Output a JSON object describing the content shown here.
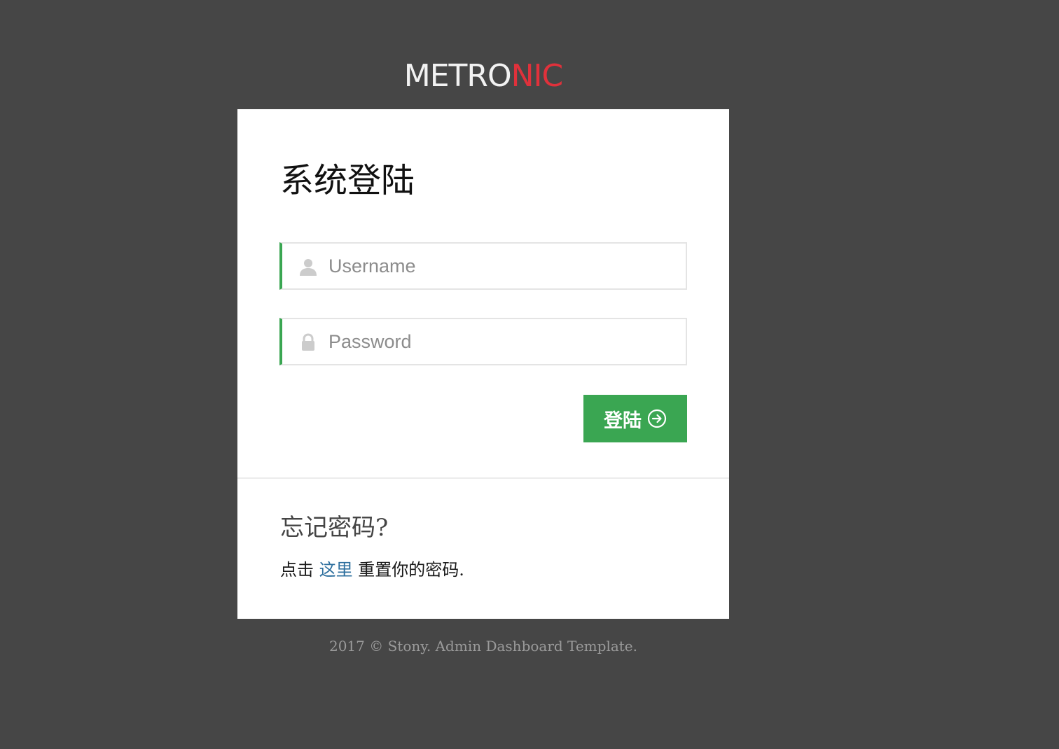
{
  "logo": {
    "part_a": "METRO",
    "part_b": "NIC"
  },
  "login": {
    "title": "系统登陆",
    "username_placeholder": "Username",
    "password_placeholder": "Password",
    "button_label": "登陆"
  },
  "forgot": {
    "title": "忘记密码?",
    "text_before": "点击",
    "link_label": "这里",
    "text_after": "重置你的密码."
  },
  "footer": {
    "text": "2017 © Stony. Admin Dashboard Template."
  },
  "colors": {
    "background": "#464646",
    "accent_green": "#3aa652",
    "logo_red": "#e0313b",
    "link_blue": "#2d6f9e"
  },
  "icons": {
    "username": "user-icon",
    "password": "lock-icon",
    "button": "arrow-right-circle-icon"
  }
}
